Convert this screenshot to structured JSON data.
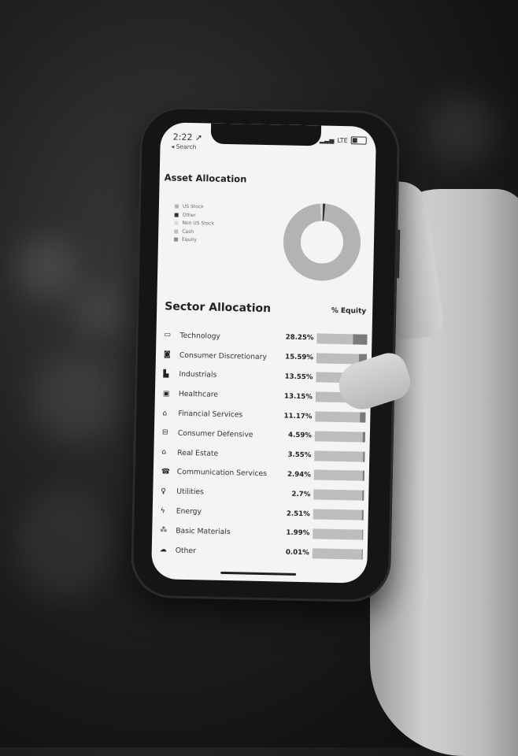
{
  "status": {
    "time": "2:22",
    "back": "◂ Search",
    "signal": "LTE"
  },
  "asset": {
    "title": "Asset Allocation",
    "legend": [
      {
        "label": "US Stock",
        "color": "#b3b3b3"
      },
      {
        "label": "Other",
        "color": "#333333"
      },
      {
        "label": "Non US Stock",
        "color": "#d9d9d9"
      },
      {
        "label": "Cash",
        "color": "#bfbfbf"
      },
      {
        "label": "Equity",
        "color": "#8c8c8c"
      }
    ]
  },
  "sector": {
    "title": "Sector Allocation",
    "column": "% Equity",
    "rows": [
      {
        "icon": "laptop-icon",
        "glyph": "▭",
        "label": "Technology",
        "pct": "28.25%",
        "value": 28.25
      },
      {
        "icon": "consumer-discretionary-icon",
        "glyph": "◙",
        "label": "Consumer Discretionary",
        "pct": "15.59%",
        "value": 15.59
      },
      {
        "icon": "factory-icon",
        "glyph": "▙",
        "label": "Industrials",
        "pct": "13.55%",
        "value": 13.55
      },
      {
        "icon": "medical-kit-icon",
        "glyph": "▣",
        "label": "Healthcare",
        "pct": "13.15%",
        "value": 13.15
      },
      {
        "icon": "bank-icon",
        "glyph": "⌂",
        "label": "Financial Services",
        "pct": "11.17%",
        "value": 11.17
      },
      {
        "icon": "basket-icon",
        "glyph": "⊟",
        "label": "Consumer Defensive",
        "pct": "4.59%",
        "value": 4.59
      },
      {
        "icon": "house-icon",
        "glyph": "⌂",
        "label": "Real Estate",
        "pct": "3.55%",
        "value": 3.55
      },
      {
        "icon": "phone-icon",
        "glyph": "☎",
        "label": "Communication Services",
        "pct": "2.94%",
        "value": 2.94
      },
      {
        "icon": "bulb-icon",
        "glyph": "♀",
        "label": "Utilities",
        "pct": "2.7%",
        "value": 2.7
      },
      {
        "icon": "lightning-icon",
        "glyph": "ϟ",
        "label": "Energy",
        "pct": "2.51%",
        "value": 2.51
      },
      {
        "icon": "materials-icon",
        "glyph": "⁂",
        "label": "Basic Materials",
        "pct": "1.99%",
        "value": 1.99
      },
      {
        "icon": "cloud-icon",
        "glyph": "☁",
        "label": "Other",
        "pct": "0.01%",
        "value": 0.01
      }
    ]
  }
}
